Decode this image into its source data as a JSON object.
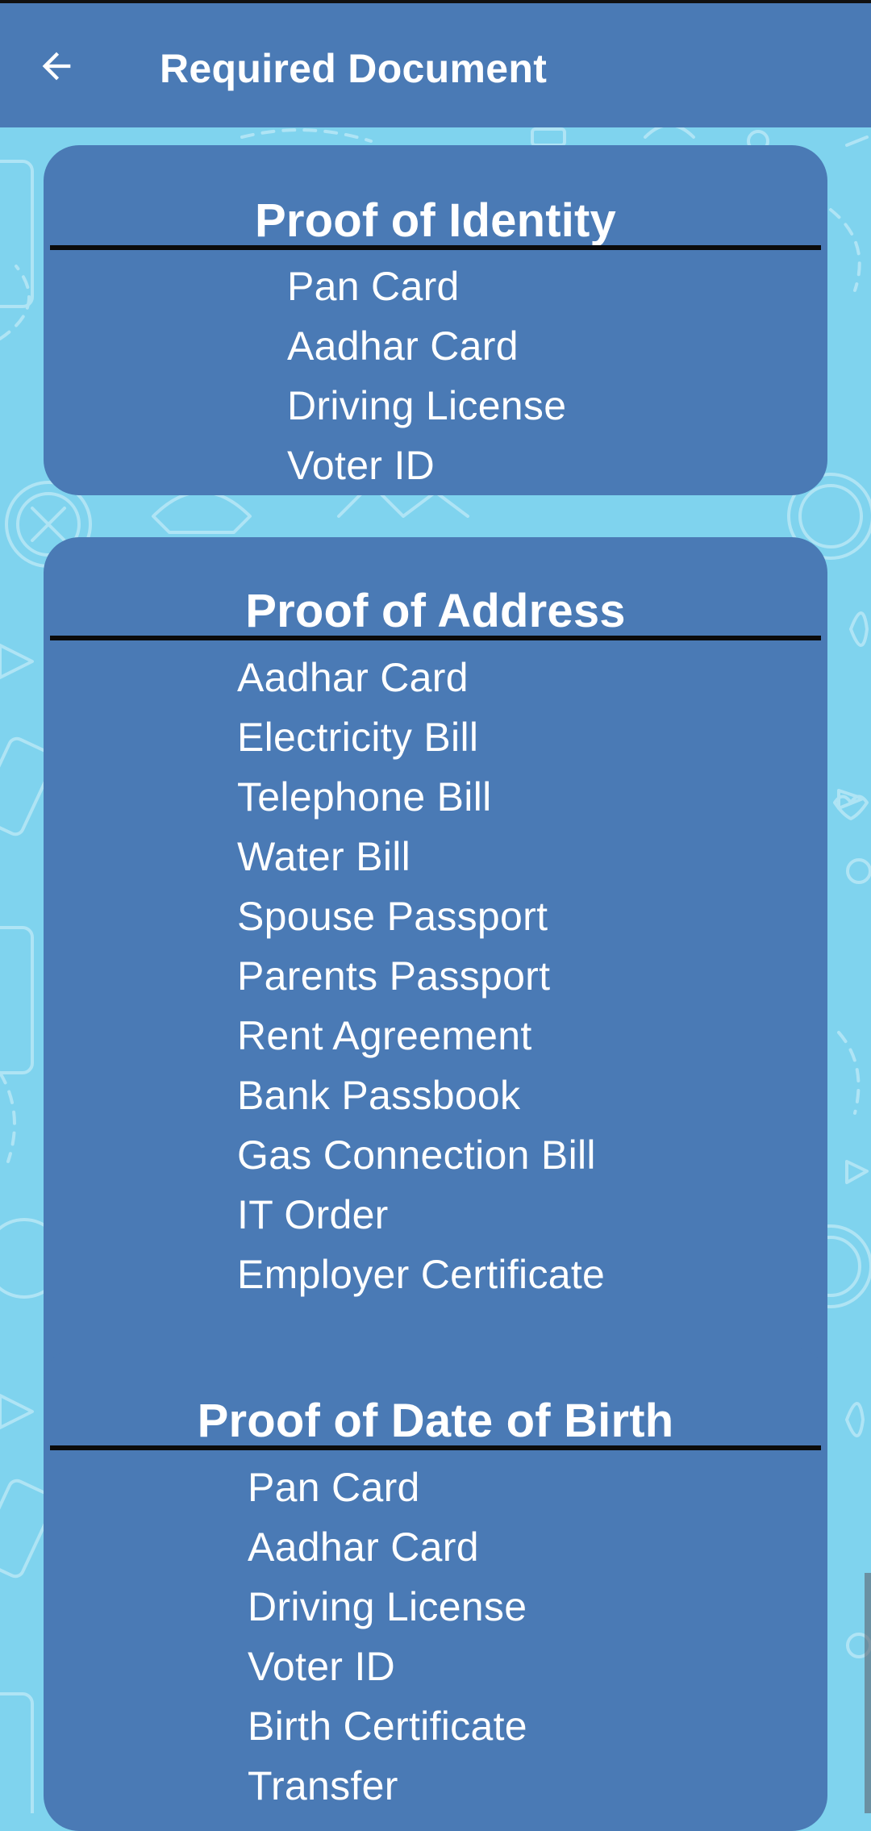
{
  "header": {
    "title": "Required Document",
    "back_icon": "arrow-left-icon"
  },
  "colors": {
    "header_bg": "#4a7ab5",
    "card_bg": "#4a7ab5",
    "page_bg": "#7fd3ee",
    "text": "#ffffff",
    "divider": "#0b0b0b"
  },
  "sections": [
    {
      "title": "Proof of Identity",
      "items": [
        "Pan Card",
        "Aadhar Card",
        "Driving License",
        "Voter ID"
      ]
    },
    {
      "title": "Proof of Address",
      "items": [
        "Aadhar Card",
        "Electricity Bill",
        "Telephone Bill",
        "Water Bill",
        "Spouse Passport",
        "Parents Passport",
        "Rent Agreement",
        "Bank Passbook",
        "Gas Connection Bill",
        "IT Order",
        "Employer Certificate"
      ]
    },
    {
      "title": "Proof of Date of Birth",
      "items": [
        "Pan Card",
        "Aadhar Card",
        "Driving License",
        "Voter ID",
        "Birth Certificate",
        "Transfer"
      ]
    }
  ]
}
